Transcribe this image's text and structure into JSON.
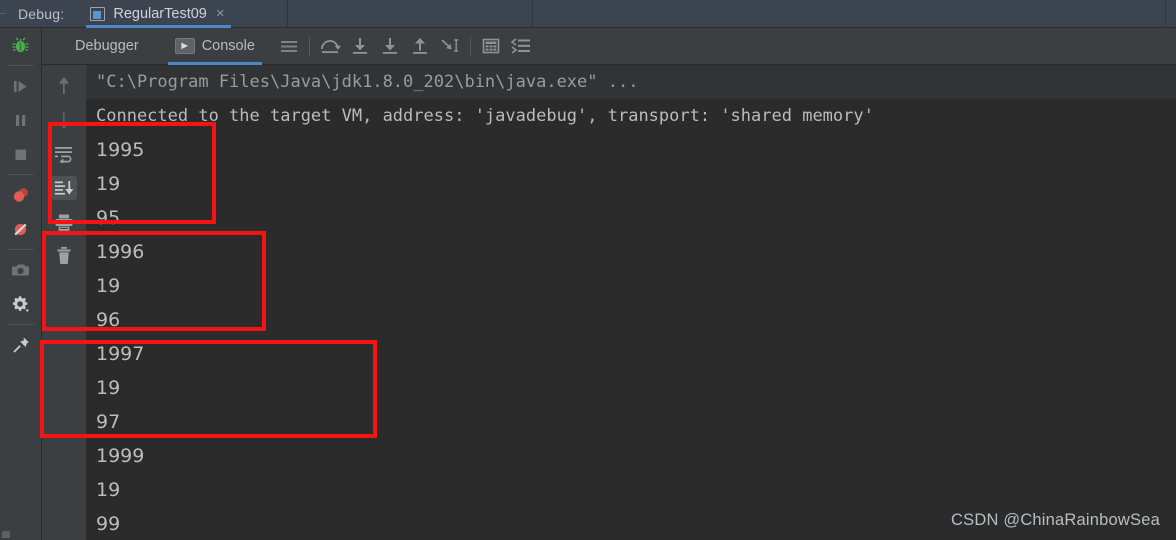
{
  "titlebar": {
    "label": "Debug:",
    "tab": {
      "name": "RegularTest09",
      "icon": "window-icon",
      "close": "×"
    }
  },
  "toolbar": {
    "tabs": [
      {
        "label": "Debugger",
        "active": false
      },
      {
        "label": "Console",
        "active": true,
        "icon": "console-play-icon"
      }
    ],
    "icons": [
      "menu-hamburger-icon",
      "step-over-icon",
      "step-into-icon",
      "force-step-into-icon",
      "step-out-icon",
      "run-to-cursor-icon",
      "evaluate-expression-icon",
      "layout-settings-icon"
    ]
  },
  "sidebar": {
    "items": [
      {
        "name": "debug-bug-icon",
        "color": "#4caf50"
      },
      {
        "name": "resume-program-icon"
      },
      {
        "name": "pause-program-icon"
      },
      {
        "name": "stop-program-icon"
      },
      {
        "name": "view-breakpoints-icon",
        "color": "#d9534f"
      },
      {
        "name": "mute-breakpoints-icon",
        "color": "#d9534f"
      },
      {
        "name": "screenshot-camera-icon"
      },
      {
        "name": "settings-gear-icon"
      },
      {
        "name": "pin-tab-icon"
      }
    ]
  },
  "gutter": {
    "items": [
      {
        "name": "up-arrow-icon",
        "active": false
      },
      {
        "name": "down-arrow-icon",
        "active": false
      },
      {
        "name": "soft-wrap-icon",
        "active": false
      },
      {
        "name": "scroll-to-end-icon",
        "active": true
      },
      {
        "name": "print-icon",
        "active": false
      },
      {
        "name": "clear-all-trash-icon",
        "active": false
      }
    ]
  },
  "console": {
    "lines": [
      {
        "text": "\"C:\\Program Files\\Java\\jdk1.8.0_202\\bin\\java.exe\" ...",
        "type": "cmd"
      },
      {
        "text": "Connected to the target VM, address: 'javadebug', transport: 'shared memory'",
        "type": "info"
      },
      {
        "text": "1995",
        "type": "out"
      },
      {
        "text": "19",
        "type": "out"
      },
      {
        "text": "95",
        "type": "out"
      },
      {
        "text": "1996",
        "type": "out"
      },
      {
        "text": "19",
        "type": "out"
      },
      {
        "text": "96",
        "type": "out"
      },
      {
        "text": "1997",
        "type": "out"
      },
      {
        "text": "19",
        "type": "out"
      },
      {
        "text": "97",
        "type": "out"
      },
      {
        "text": "1999",
        "type": "out"
      },
      {
        "text": "19",
        "type": "out"
      },
      {
        "text": "99",
        "type": "out"
      }
    ]
  },
  "annotations": {
    "color": "#f51414",
    "boxes": [
      {
        "name": "highlight-box-1995-group"
      },
      {
        "name": "highlight-box-1996-group"
      },
      {
        "name": "highlight-box-1997-group"
      }
    ]
  },
  "watermark": {
    "text": "CSDN @ChinaRainbowSea"
  },
  "colors": {
    "titlebar_bg": "#3c4450",
    "panel_bg": "#3c3f41",
    "console_bg": "#2b2b2b",
    "accent_blue": "#4a88c7",
    "annotation_red": "#f51414",
    "text": "#bbbbbb"
  }
}
